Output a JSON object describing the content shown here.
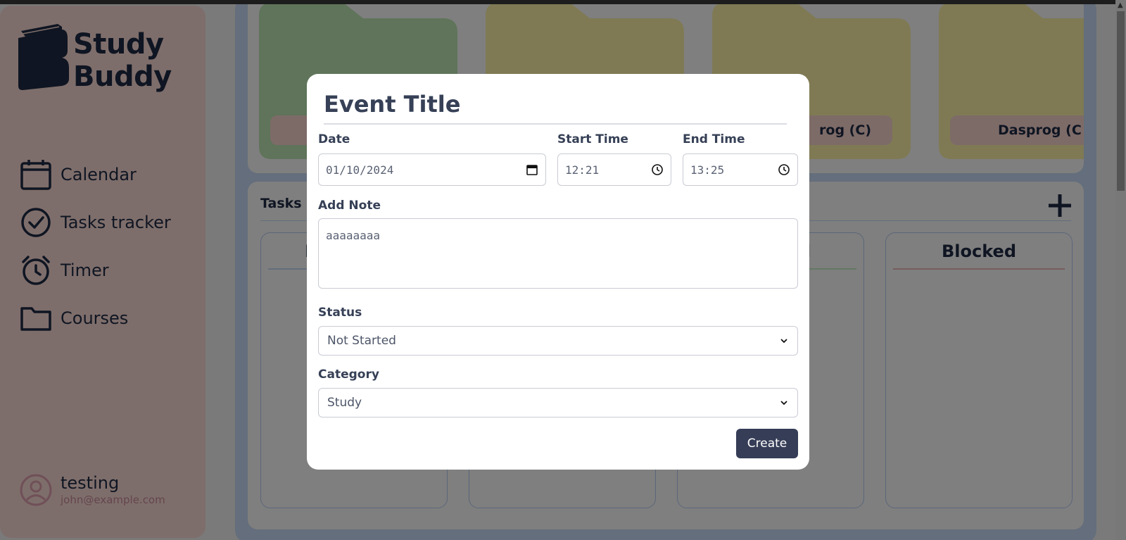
{
  "brand": {
    "line1": "Study",
    "line2": "Buddy"
  },
  "nav": [
    {
      "label": "Calendar",
      "icon": "calendar-icon"
    },
    {
      "label": "Tasks tracker",
      "icon": "check-circle-icon"
    },
    {
      "label": "Timer",
      "icon": "alarm-clock-icon"
    },
    {
      "label": "Courses",
      "icon": "folder-icon"
    }
  ],
  "profile": {
    "name": "testing",
    "email": "john@example.com"
  },
  "folders": [
    {
      "label": "",
      "color": "#bfe8b4"
    },
    {
      "label": "",
      "color": "#fff4a8"
    },
    {
      "label": "rog (C)",
      "color": "#fff4a8"
    },
    {
      "label": "Dasprog (C",
      "color": "#fff4a8"
    }
  ],
  "tasks": {
    "title": "Tasks p",
    "columns": [
      {
        "title": "I",
        "line_color": "#c8dcf8"
      },
      {
        "title": "",
        "line_color": "#c8dcf8"
      },
      {
        "title": "d",
        "line_color": "#c8f0c8"
      },
      {
        "title": "Blocked",
        "line_color": "#f0b8b8"
      }
    ]
  },
  "modal": {
    "title": "Event Title",
    "date_label": "Date",
    "date_value": "01/10/2024",
    "start_label": "Start Time",
    "start_value": "12:21",
    "end_label": "End Time",
    "end_value": "13:25",
    "note_label": "Add Note",
    "note_value": "aaaaaaaa",
    "status_label": "Status",
    "status_value": "Not Started",
    "category_label": "Category",
    "category_value": "Study",
    "create_label": "Create"
  },
  "colors": {
    "accent": "#353d57",
    "sidebar": "#fcdcd6",
    "frame": "#c8dcf8"
  }
}
